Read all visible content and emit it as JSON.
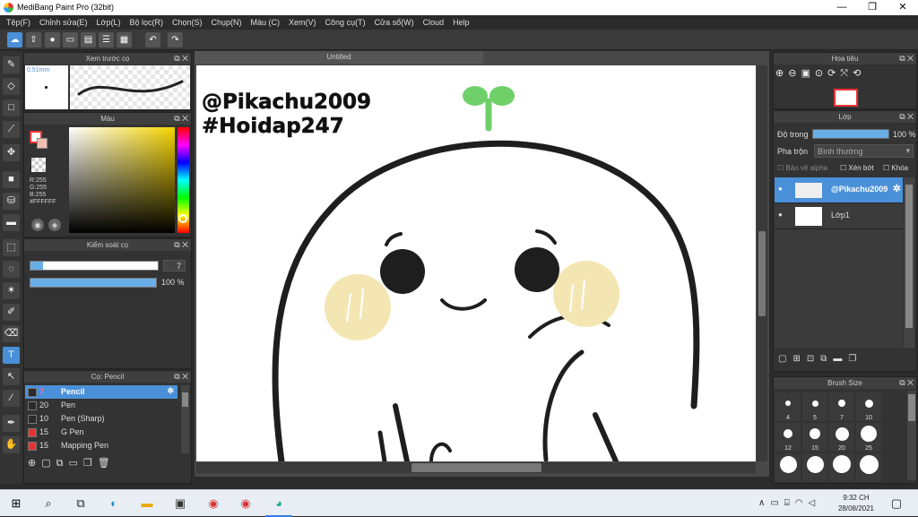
{
  "window": {
    "title": "MediBang Paint Pro (32bit)",
    "min": "—",
    "max": "❐",
    "close": "✕"
  },
  "menu": [
    "Tệp(F)",
    "Chỉnh sửa(E)",
    "Lớp(L)",
    "Bộ lọc(R)",
    "Chọn(S)",
    "Chụp(N)",
    "Màu (C)",
    "Xem(V)",
    "Công cụ(T)",
    "Cửa sổ(W)",
    "Cloud",
    "Help"
  ],
  "preview_panel": {
    "title": "Xem trước cọ",
    "size": "0.51mm"
  },
  "color_panel": {
    "title": "Màu",
    "r": "R:255",
    "g": "G:255",
    "b": "B:255",
    "hex": "#FFFFFF"
  },
  "brush_control": {
    "title": "Kiểm soát cọ",
    "size_value": "7",
    "opacity_value": "100 %",
    "size_level": 0.1,
    "opacity_level": 1.0
  },
  "brush_panel": {
    "title": "Cọ: Pencil",
    "items": [
      {
        "size": "7",
        "name": "Pencil",
        "color": "#2b2b2b",
        "selected": true
      },
      {
        "size": "20",
        "name": "Pen",
        "color": "#2b2b2b"
      },
      {
        "size": "10",
        "name": "Pen (Sharp)",
        "color": "#2b2b2b"
      },
      {
        "size": "15",
        "name": "G Pen",
        "color": "#e53333"
      },
      {
        "size": "15",
        "name": "Mapping Pen",
        "color": "#e53333"
      }
    ]
  },
  "canvas": {
    "tab": "Untitled",
    "text_line1": "@Pikachu2009",
    "text_line2": "#Hoidap247"
  },
  "navigator": {
    "title": "Hoa tiêu"
  },
  "layer_panel": {
    "title": "Lớp",
    "opacity_label": "Độ trong",
    "opacity_value": "100 %",
    "opacity_level": 1.0,
    "blend_label": "Pha trộn",
    "blend_value": "Bình thường",
    "protect_alpha": "Bảo vệ alpha",
    "clip": "Xén bớt",
    "lock": "Khóa",
    "layers": [
      {
        "name": "@Pikachu2009",
        "selected": true
      },
      {
        "name": "Lớp1",
        "selected": false
      }
    ]
  },
  "brush_size_panel": {
    "title": "Brush Size",
    "sizes": [
      "4",
      "5",
      "7",
      "10",
      "12",
      "15",
      "20",
      "25",
      "",
      "",
      "",
      ""
    ],
    "dot_scales": [
      0.15,
      0.2,
      0.28,
      0.38,
      0.45,
      0.55,
      0.75,
      1.0,
      1.05,
      1.1,
      1.15,
      1.2
    ]
  },
  "taskbar": {
    "time": "9:32 CH",
    "date": "28/08/2021"
  },
  "colors": {
    "accent": "#4a90d9",
    "panel": "#333333",
    "selected_row": "#4a90d9"
  }
}
